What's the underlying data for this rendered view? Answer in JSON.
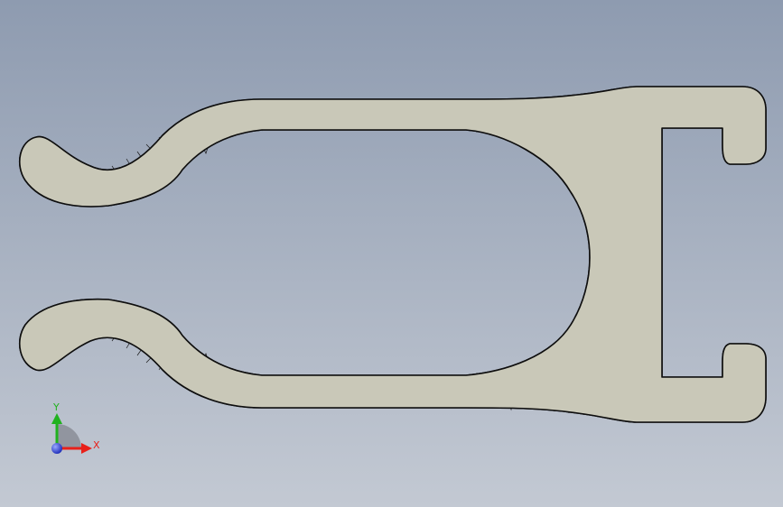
{
  "viewport": {
    "background_top": "#8e9bb0",
    "background_bottom": "#c3c9d3"
  },
  "model": {
    "face_color": "#c9c8b8",
    "edge_color": "#0e0e0e",
    "mesh_line_color": "#1a1a1a"
  },
  "triad": {
    "x_label": "X",
    "y_label": "Y",
    "x_color": "#e8201a",
    "y_color": "#21b21f",
    "z_color": "#2a3adf"
  }
}
